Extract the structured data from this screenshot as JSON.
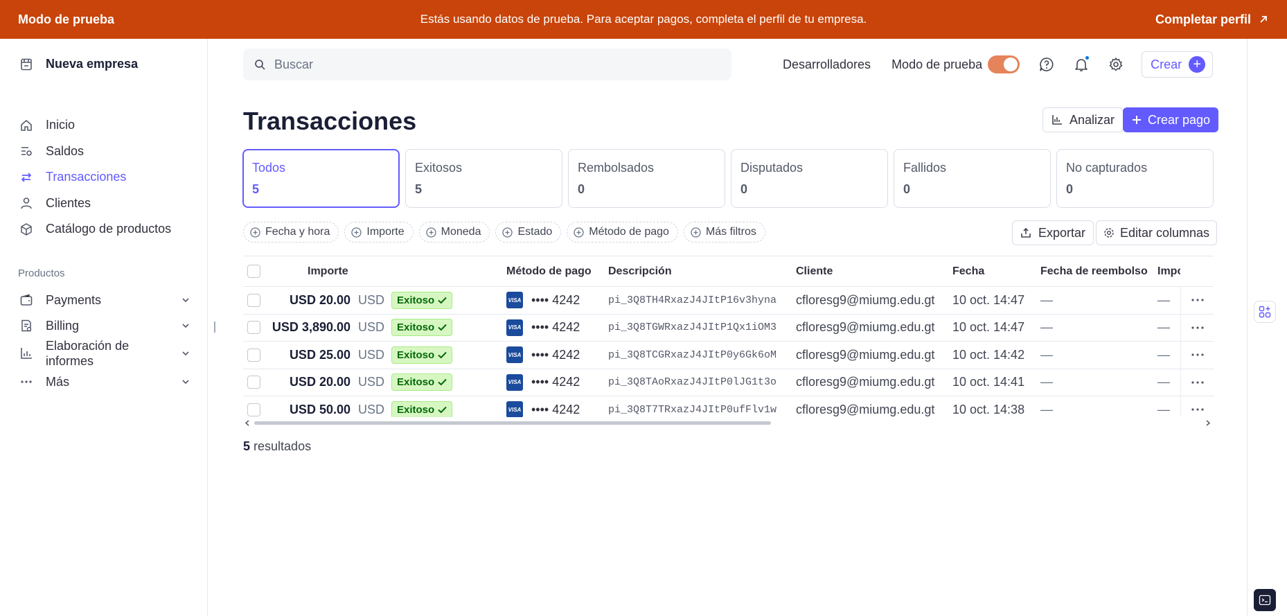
{
  "banner": {
    "left": "Modo de prueba",
    "message": "Estás usando datos de prueba. Para aceptar pagos, completa el perfil de tu empresa.",
    "cta": "Completar perfil"
  },
  "sidebar": {
    "company": "Nueva empresa",
    "items": [
      {
        "label": "Inicio",
        "icon": "home-icon"
      },
      {
        "label": "Saldos",
        "icon": "balances-icon"
      },
      {
        "label": "Transacciones",
        "icon": "transactions-icon",
        "active": true
      },
      {
        "label": "Clientes",
        "icon": "person-icon"
      },
      {
        "label": "Catálogo de productos",
        "icon": "box-icon"
      }
    ],
    "products_label": "Productos",
    "products": [
      {
        "label": "Payments",
        "icon": "wallet-icon"
      },
      {
        "label": "Billing",
        "icon": "billing-icon"
      },
      {
        "label": "Elaboración de informes",
        "icon": "reports-icon"
      },
      {
        "label": "Más",
        "icon": "more-icon"
      }
    ]
  },
  "header": {
    "search_placeholder": "Buscar",
    "developers": "Desarrolladores",
    "test_mode": "Modo de prueba",
    "create": "Crear"
  },
  "page": {
    "title": "Transacciones",
    "analyze": "Analizar",
    "create_payment": "Crear pago"
  },
  "tabs": [
    {
      "label": "Todos",
      "count": "5",
      "active": true
    },
    {
      "label": "Exitosos",
      "count": "5"
    },
    {
      "label": "Rembolsados",
      "count": "0"
    },
    {
      "label": "Disputados",
      "count": "0"
    },
    {
      "label": "Fallidos",
      "count": "0"
    },
    {
      "label": "No capturados",
      "count": "0"
    }
  ],
  "filters": [
    "Fecha y hora",
    "Importe",
    "Moneda",
    "Estado",
    "Método de pago",
    "Más filtros"
  ],
  "export": "Exportar",
  "edit_columns": "Editar columnas",
  "table": {
    "headers": {
      "amount": "Importe",
      "method": "Método de pago",
      "description": "Descripción",
      "customer": "Cliente",
      "date": "Fecha",
      "refund_date": "Fecha de reembolso",
      "extra": "Impo"
    },
    "rows": [
      {
        "amount": "USD 20.00",
        "currency": "USD",
        "status": "Exitoso",
        "card": "•••• 4242",
        "description": "pi_3Q8TH4RxazJ4JItP16v3hyna",
        "customer": "cfloresg9@miumg.edu.gt",
        "date": "10 oct. 14:47",
        "refund_date": "—",
        "extra": "—"
      },
      {
        "amount": "USD 3,890.00",
        "currency": "USD",
        "status": "Exitoso",
        "card": "•••• 4242",
        "description": "pi_3Q8TGWRxazJ4JItP1Qx1iOM3",
        "customer": "cfloresg9@miumg.edu.gt",
        "date": "10 oct. 14:47",
        "refund_date": "—",
        "extra": "—"
      },
      {
        "amount": "USD 25.00",
        "currency": "USD",
        "status": "Exitoso",
        "card": "•••• 4242",
        "description": "pi_3Q8TCGRxazJ4JItP0y6Gk6oM",
        "customer": "cfloresg9@miumg.edu.gt",
        "date": "10 oct. 14:42",
        "refund_date": "—",
        "extra": "—"
      },
      {
        "amount": "USD 20.00",
        "currency": "USD",
        "status": "Exitoso",
        "card": "•••• 4242",
        "description": "pi_3Q8TAoRxazJ4JItP0lJG1t3o",
        "customer": "cfloresg9@miumg.edu.gt",
        "date": "10 oct. 14:41",
        "refund_date": "—",
        "extra": "—"
      },
      {
        "amount": "USD 50.00",
        "currency": "USD",
        "status": "Exitoso",
        "card": "•••• 4242",
        "description": "pi_3Q8T7TRxazJ4JItP0ufFlv1w",
        "customer": "cfloresg9@miumg.edu.gt",
        "date": "10 oct. 14:38",
        "refund_date": "—",
        "extra": "—"
      }
    ],
    "card_brand": "VISA"
  },
  "results": {
    "count": "5",
    "label": "resultados"
  },
  "colors": {
    "banner": "#c9440a",
    "accent": "#635bff",
    "success_bg": "#d7f7c2",
    "success_text": "#006908"
  }
}
